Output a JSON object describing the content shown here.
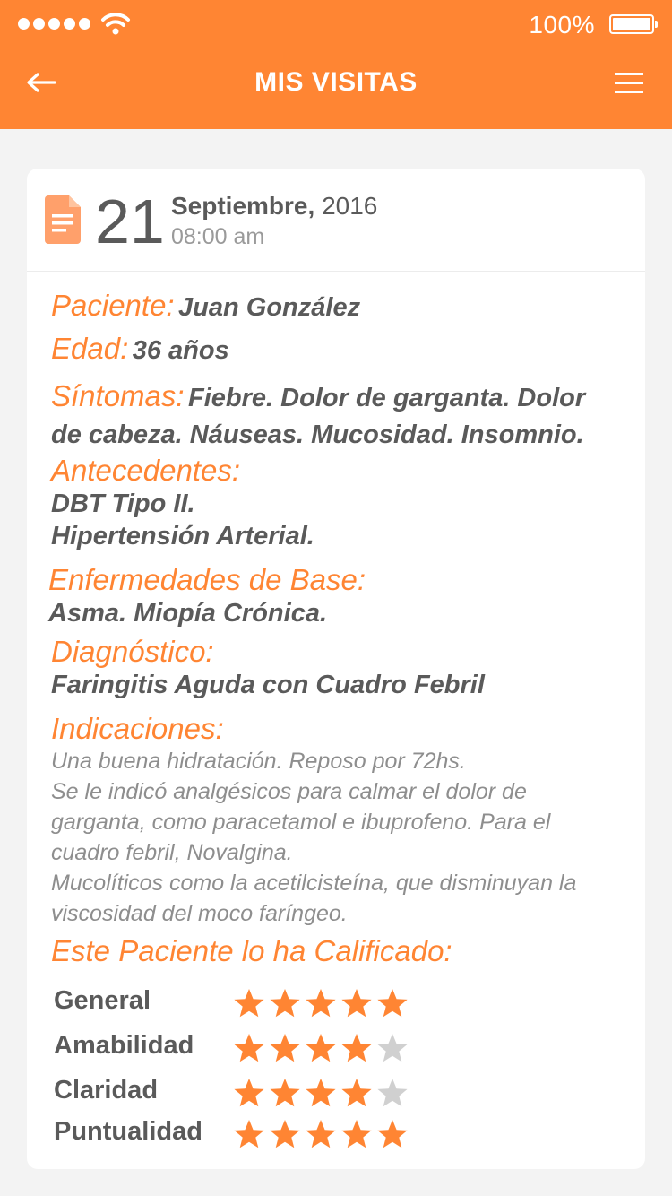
{
  "status_bar": {
    "battery_percent": "100%",
    "signal_dots": 5
  },
  "header": {
    "title": "MIS VISITAS",
    "back_icon": "arrow-left-icon",
    "menu_icon": "hamburger-menu-icon"
  },
  "visit": {
    "day": "21",
    "month": "Septiembre,",
    "year": "2016",
    "time": "08:00 am",
    "icon": "document-icon",
    "paciente_label": "Paciente:",
    "paciente": "Juan González",
    "edad_label": "Edad:",
    "edad": "36 años",
    "sintomas_label": "Síntomas:",
    "sintomas_line1": "Fiebre. Dolor de garganta. Dolor",
    "sintomas_line2": "de cabeza. Náuseas. Mucosidad. Insomnio.",
    "antecedentes_label": "Antecedentes:",
    "antecedentes_line1": "DBT Tipo II.",
    "antecedentes_line2": "Hipertensión Arterial.",
    "enfermedades_label": "Enfermedades de Base:",
    "enfermedades": "Asma. Miopía Crónica.",
    "diagnostico_label": "Diagnóstico:",
    "diagnostico": "Faringitis Aguda con Cuadro Febril",
    "indicaciones_label": "Indicaciones:",
    "indicaciones_lines": [
      "Una buena hidratación. Reposo por 72hs.",
      "Se le indicó analgésicos para calmar el dolor de",
      "garganta, como paracetamol e ibuprofeno. Para el",
      "cuadro febril, Novalgina.",
      "Mucolíticos como la acetilcisteína, que disminuyan la",
      "viscosidad del moco faríngeo."
    ],
    "calificacion_label": "Este Paciente lo ha Calificado:"
  },
  "ratings": [
    {
      "label": "General",
      "stars": 5
    },
    {
      "label": "Amabilidad",
      "stars": 4
    },
    {
      "label": "Claridad",
      "stars": 4
    },
    {
      "label": "Puntualidad",
      "stars": 5
    }
  ],
  "colors": {
    "accent": "#ff8533",
    "star_filled": "#ff8533",
    "star_empty": "#d0d0d0"
  }
}
